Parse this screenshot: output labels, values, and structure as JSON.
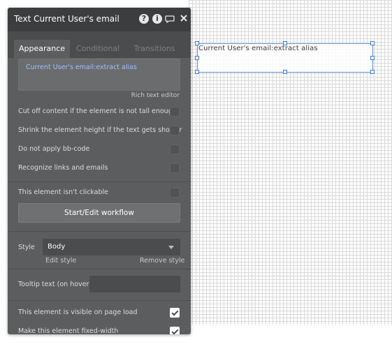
{
  "canvas": {
    "element_text": "Current User's email:extract alias"
  },
  "panel": {
    "title": "Text Current User's email",
    "icons": [
      "help-icon",
      "info-icon",
      "comment-icon",
      "close-icon"
    ],
    "tabs": [
      "Appearance",
      "Conditional",
      "Transitions"
    ],
    "content_expression": "Current User's email:extract alias",
    "rich_text_editor_label": "Rich text editor",
    "options": [
      {
        "label": "Cut off content if the element is not tall enough",
        "checked": false
      },
      {
        "label": "Shrink the element height if the text gets shorter",
        "checked": false
      },
      {
        "label": "Do not apply bb-code",
        "checked": false
      },
      {
        "label": "Recognize links and emails",
        "checked": false
      }
    ],
    "not_clickable_label": "This element isn't clickable",
    "workflow_button": "Start/Edit workflow",
    "style_label": "Style",
    "style_value": "Body",
    "edit_style": "Edit style",
    "remove_style": "Remove style",
    "tooltip_label": "Tooltip text (on hover)",
    "tooltip_value": "",
    "visible_on_load_label": "This element is visible on page load",
    "fixed_width_label": "Make this element fixed-width"
  },
  "colors": {
    "panel_bg": "#5b5d5f",
    "header_bg": "#3b3d3f",
    "expression_blue": "#9ec2ff",
    "selection_blue": "#3a78d1"
  }
}
